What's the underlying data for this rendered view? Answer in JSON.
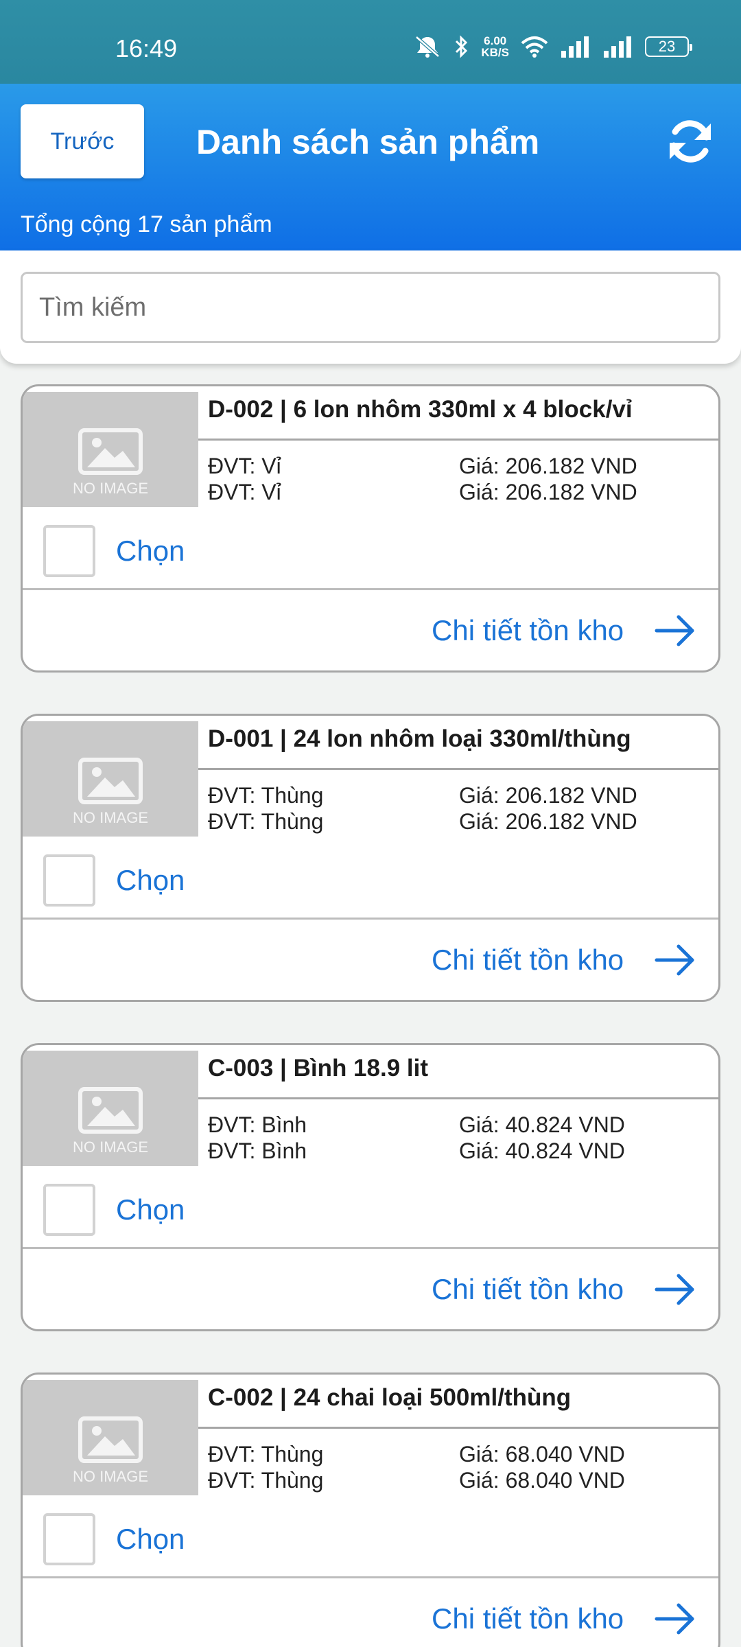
{
  "status_bar": {
    "time": "16:49",
    "net_speed_value": "6.00",
    "net_speed_unit": "KB/S",
    "battery": "23"
  },
  "header": {
    "back_label": "Trước",
    "title": "Danh sách sản phẩm",
    "total_label": "Tổng cộng 17 sản phẩm",
    "accent_color": "#1a73d6"
  },
  "search": {
    "placeholder": "Tìm kiếm",
    "value": ""
  },
  "no_image_label": "NO IMAGE",
  "products": [
    {
      "title": "D-002 | 6 lon nhôm 330ml x 4 block/vỉ",
      "units": [
        "ĐVT: Vỉ",
        "ĐVT: Vỉ"
      ],
      "prices": [
        "Giá: 206.182 VND",
        "Giá: 206.182 VND"
      ],
      "select_label": "Chọn",
      "inventory_label": "Chi tiết tồn kho"
    },
    {
      "title": "D-001 | 24 lon nhôm loại 330ml/thùng",
      "units": [
        "ĐVT: Thùng",
        "ĐVT: Thùng"
      ],
      "prices": [
        "Giá: 206.182 VND",
        "Giá: 206.182 VND"
      ],
      "select_label": "Chọn",
      "inventory_label": "Chi tiết tồn kho"
    },
    {
      "title": "C-003 | Bình 18.9 lit",
      "units": [
        "ĐVT: Bình",
        "ĐVT: Bình"
      ],
      "prices": [
        "Giá: 40.824 VND",
        "Giá: 40.824 VND"
      ],
      "select_label": "Chọn",
      "inventory_label": "Chi tiết tồn kho"
    },
    {
      "title": "C-002 | 24 chai loại 500ml/thùng",
      "units": [
        "ĐVT: Thùng",
        "ĐVT: Thùng"
      ],
      "prices": [
        "Giá: 68.040 VND",
        "Giá: 68.040 VND"
      ],
      "select_label": "Chọn",
      "inventory_label": "Chi tiết tồn kho"
    }
  ]
}
